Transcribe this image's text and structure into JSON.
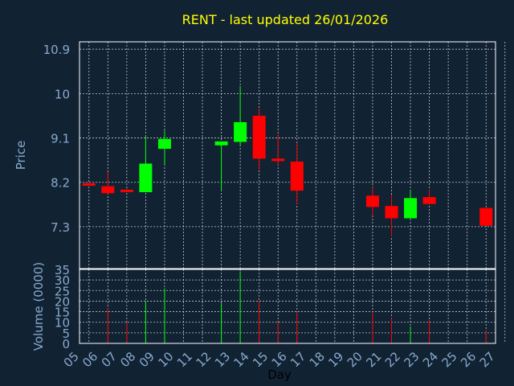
{
  "colors": {
    "background": "#112233",
    "plot_border": "#ffffff",
    "grid": "#ffffff",
    "text": "#88aacc",
    "title": "#ffff00",
    "up": "#00ff00",
    "down": "#ff0000"
  },
  "chart_data": {
    "type": "candlestick",
    "title": "RENT - last updated 26/01/2026",
    "xlabel": "Day",
    "price_axis": {
      "label": "Price",
      "ticks": [
        "10.9",
        "10",
        "9.1",
        "8.2",
        "7.3"
      ],
      "tick_values": [
        10.9,
        10.0,
        9.1,
        8.2,
        7.3
      ],
      "ylim": [
        6.45,
        11.05
      ]
    },
    "volume_axis": {
      "label": "Volume (0000)",
      "ticks": [
        "35",
        "30",
        "25",
        "20",
        "15",
        "10",
        "5",
        "0"
      ],
      "tick_values": [
        35,
        30,
        25,
        20,
        15,
        10,
        5,
        0
      ],
      "ylim": [
        0,
        35
      ]
    },
    "x_ticks": [
      "05",
      "06",
      "07",
      "08",
      "09",
      "10",
      "11",
      "12",
      "13",
      "14",
      "15",
      "16",
      "17",
      "18",
      "19",
      "20",
      "21",
      "22",
      "23",
      "24",
      "25",
      "26",
      "27"
    ],
    "grid": true,
    "candles": [
      {
        "day": "05",
        "open": 8.18,
        "high": 8.2,
        "low": 8.15,
        "close": 8.15,
        "volume": 0
      },
      {
        "day": "06",
        "open": 8.12,
        "high": 8.4,
        "low": 7.96,
        "close": 7.98,
        "volume": 17
      },
      {
        "day": "07",
        "open": 8.05,
        "high": 8.08,
        "low": 8.0,
        "close": 8.02,
        "volume": 10
      },
      {
        "day": "08",
        "open": 8.0,
        "high": 9.15,
        "low": 8.0,
        "close": 8.58,
        "volume": 20
      },
      {
        "day": "09",
        "open": 8.88,
        "high": 9.25,
        "low": 8.55,
        "close": 9.08,
        "volume": 26
      },
      {
        "day": "12",
        "open": 8.95,
        "high": 9.0,
        "low": 8.05,
        "close": 9.03,
        "volume": 19
      },
      {
        "day": "13",
        "open": 9.02,
        "high": 10.15,
        "low": 8.95,
        "close": 9.42,
        "volume": 34
      },
      {
        "day": "14",
        "open": 9.55,
        "high": 9.7,
        "low": 8.45,
        "close": 8.68,
        "volume": 20
      },
      {
        "day": "15",
        "open": 8.68,
        "high": 9.2,
        "low": 8.55,
        "close": 8.63,
        "volume": 10
      },
      {
        "day": "16",
        "open": 8.62,
        "high": 9.0,
        "low": 7.75,
        "close": 8.03,
        "volume": 15
      },
      {
        "day": "20",
        "open": 7.93,
        "high": 8.1,
        "low": 7.52,
        "close": 7.7,
        "volume": 15
      },
      {
        "day": "21",
        "open": 7.72,
        "high": 7.95,
        "low": 7.1,
        "close": 7.47,
        "volume": 12
      },
      {
        "day": "22",
        "open": 7.47,
        "high": 8.05,
        "low": 7.47,
        "close": 7.88,
        "volume": 8
      },
      {
        "day": "23",
        "open": 7.9,
        "high": 8.05,
        "low": 7.75,
        "close": 7.76,
        "volume": 11
      },
      {
        "day": "26",
        "open": 7.68,
        "high": 7.68,
        "low": 7.32,
        "close": 7.32,
        "volume": 6
      }
    ]
  }
}
